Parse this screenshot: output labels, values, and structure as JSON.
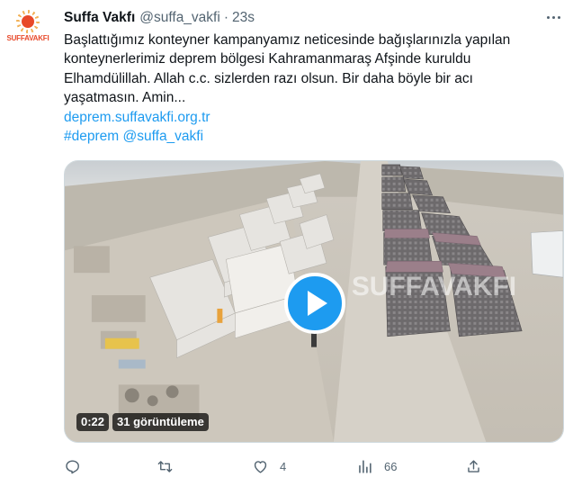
{
  "account": {
    "avatar_text": "SUFFAVAKFI",
    "name": "Suffa Vakfı",
    "handle": "@suffa_vakfi",
    "separator": "·",
    "time": "23s"
  },
  "tweet": {
    "lines": [
      "Başlattığımız konteyner kampanyamız neticesinde bağışlarınızla yapılan",
      "konteynerlerimiz deprem bölgesi Kahramanmaraş Afşinde kuruldu",
      "Elhamdülillah. Allah c.c. sizlerden razı olsun. Bir daha böyle bir acı",
      "yaşatmasın. Amin..."
    ],
    "link": "deprem.suffavakfi.org.tr",
    "hashtag": "#deprem",
    "mention": "@suffa_vakfi"
  },
  "video": {
    "duration": "0:22",
    "views": "31 görüntüleme",
    "watermark": "SUFFAVAKFI"
  },
  "actions": {
    "reply_count": "",
    "retweet_count": "",
    "like_count": "4",
    "views_count": "66"
  },
  "colors": {
    "accent": "#1d9bf0",
    "secondary_text": "#536471",
    "brand": "#e8492a"
  }
}
